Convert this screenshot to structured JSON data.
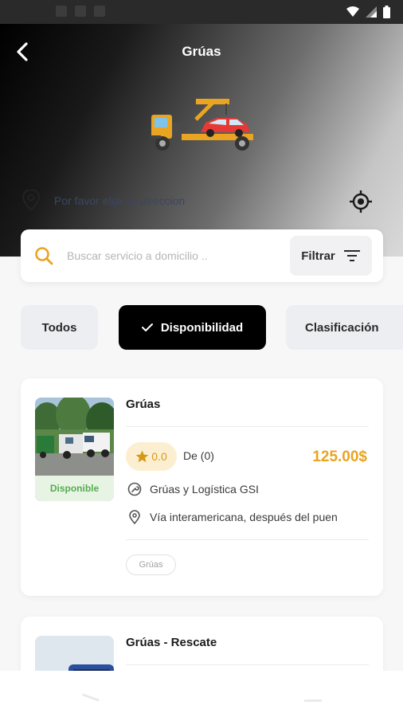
{
  "header": {
    "title": "Grúas",
    "address_placeholder": "Por favor elija su direccion"
  },
  "search": {
    "placeholder": "Buscar servicio a domicilio ..",
    "filter_label": "Filtrar"
  },
  "chips": [
    {
      "label": "Todos",
      "selected": false
    },
    {
      "label": "Disponibilidad",
      "selected": true
    },
    {
      "label": "Clasificación",
      "selected": false
    }
  ],
  "listings": [
    {
      "name": "Grúas",
      "status": "Disponible",
      "rating": "0.0",
      "reviews": "De (0)",
      "price": "125.00$",
      "company": "Grúas y Logística GSI",
      "address": "Vía interamericana, después del puen",
      "tag": "Grúas"
    },
    {
      "name": "Grúas - Rescate"
    }
  ],
  "colors": {
    "accent": "#e9a521",
    "available_bg": "#e7f4e4",
    "available_text": "#57ab4f",
    "selected_chip": "#000000"
  }
}
